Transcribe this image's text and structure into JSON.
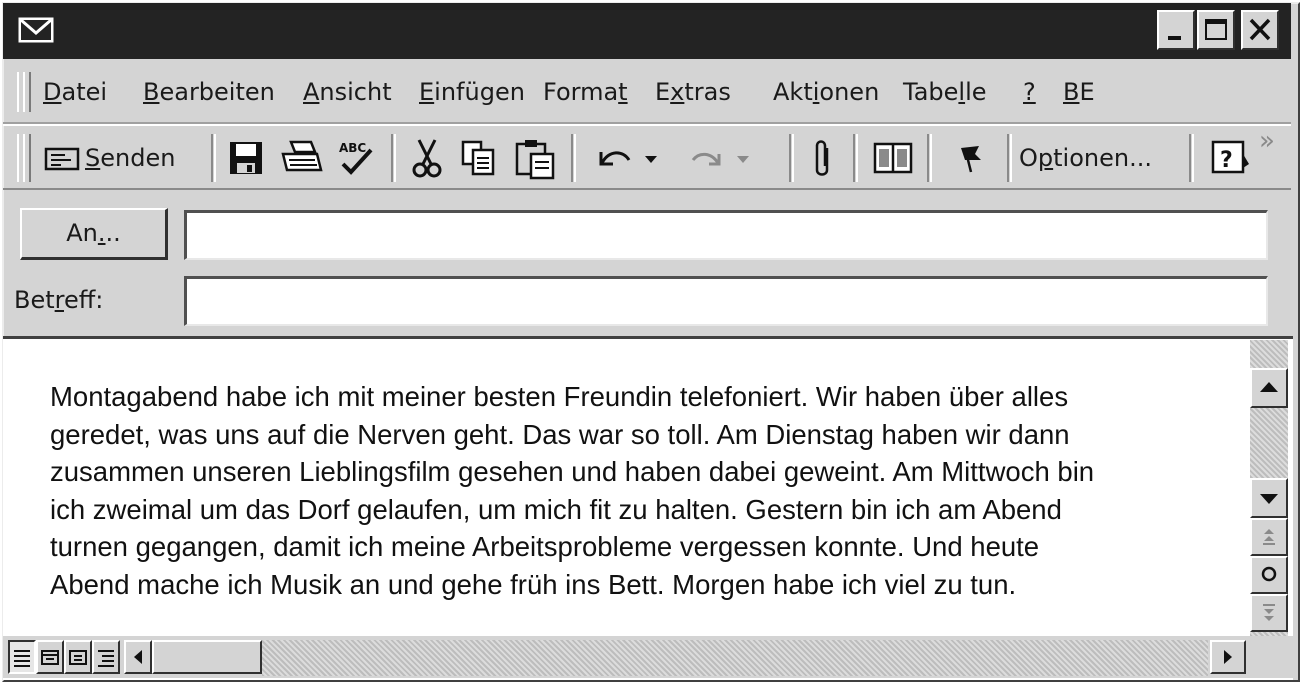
{
  "titlebar": {
    "icon": "envelope-icon",
    "buttons": [
      "minimize-icon",
      "maximize-icon",
      "close-icon"
    ]
  },
  "menubar": {
    "items": [
      {
        "pre": "",
        "key": "D",
        "post": "atei"
      },
      {
        "pre": "",
        "key": "B",
        "post": "earbeiten"
      },
      {
        "pre": "",
        "key": "A",
        "post": "nsicht"
      },
      {
        "pre": "",
        "key": "E",
        "post": "infügen"
      },
      {
        "pre": "Forma",
        "key": "t",
        "post": ""
      },
      {
        "pre": "E",
        "key": "x",
        "post": "tras"
      },
      {
        "pre": "Akt",
        "key": "i",
        "post": "onen"
      },
      {
        "pre": "Tabe",
        "key": "l",
        "post": "le"
      },
      {
        "pre": "",
        "key": "?",
        "post": ""
      },
      {
        "pre": "",
        "key": "B",
        "post": "E"
      }
    ]
  },
  "toolbar": {
    "send": {
      "pre": "",
      "key": "S",
      "post": "enden"
    },
    "options": {
      "pre": "O",
      "key": "p",
      "post": "tionen..."
    },
    "overflow": "»",
    "icons": [
      "send-icon",
      "save-icon",
      "print-icon",
      "spellcheck-icon",
      "cut-icon",
      "copy-icon",
      "paste-icon",
      "undo-icon",
      "redo-icon",
      "attach-icon",
      "address-book-icon",
      "flag-icon",
      "help-icon"
    ]
  },
  "header": {
    "to_button": {
      "pre": "An",
      "key": ".",
      "post": ".."
    },
    "to_value": "",
    "subject_label": {
      "pre": "Bet",
      "key": "r",
      "post": "eff:"
    },
    "subject_value": ""
  },
  "message": {
    "lines": [
      "Montagabend habe ich mit meiner besten Freundin telefoniert. Wir haben über alles",
      "geredet, was uns auf die Nerven geht. Das war so toll. Am Dienstag haben wir dann",
      "zusammen unseren Lieblingsfilm gesehen und haben dabei geweint. Am Mittwoch bin",
      "ich zweimal um das Dorf gelaufen, um mich fit zu halten. Gestern bin ich am Abend",
      "turnen gegangen, damit ich meine Arbeitsprobleme vergessen konnte. Und heute",
      "Abend mache ich Musik an und gehe früh ins Bett. Morgen habe ich viel zu tun."
    ]
  },
  "statusbar": {
    "view_buttons": [
      "normal-view-icon",
      "web-layout-icon",
      "print-layout-icon",
      "outline-view-icon"
    ]
  }
}
